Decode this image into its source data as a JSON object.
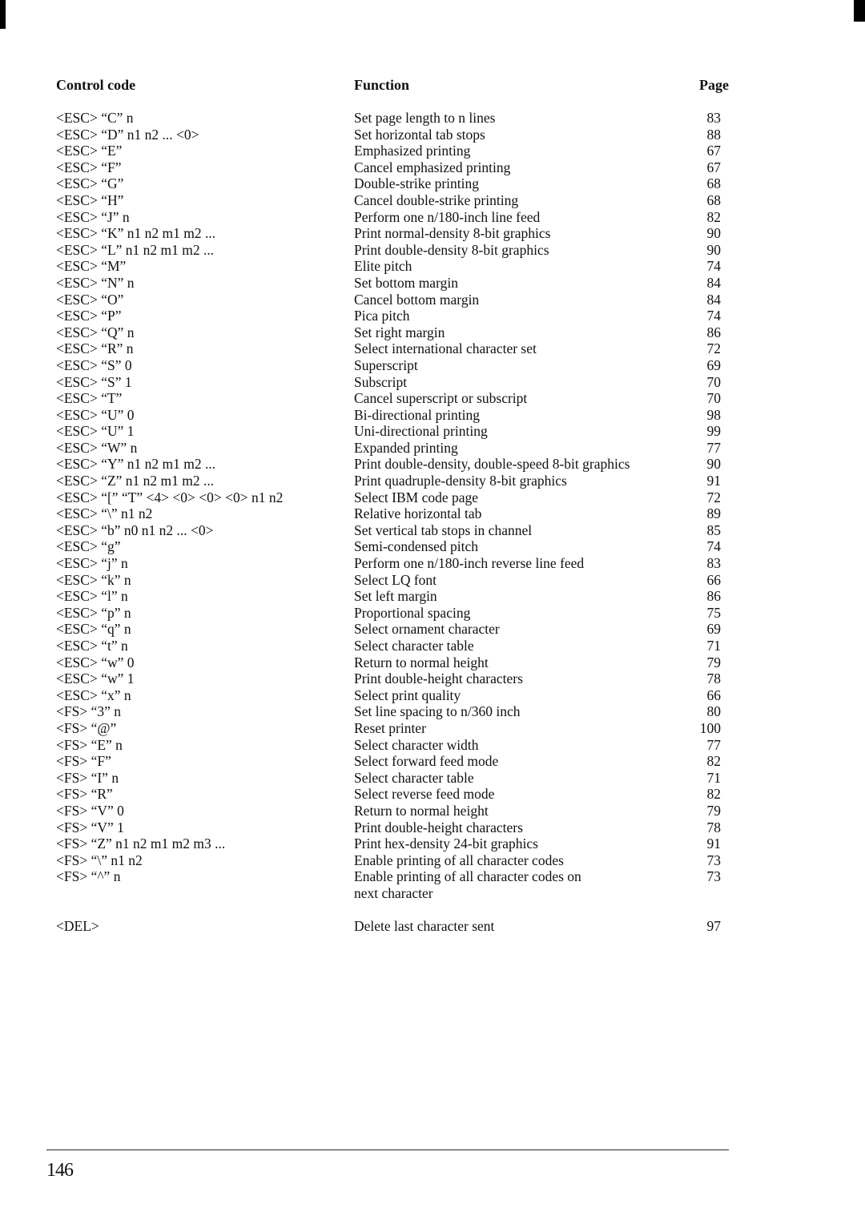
{
  "headers": {
    "control_code": "Control code",
    "function": "Function",
    "page": "Page"
  },
  "rows": [
    {
      "code": "<ESC> “C” n",
      "function": "Set page length to n lines",
      "page": "83"
    },
    {
      "code": "<ESC> “D” n1 n2 ... <0>",
      "function": "Set horizontal tab stops",
      "page": "88"
    },
    {
      "code": "<ESC> “E”",
      "function": "Emphasized printing",
      "page": "67"
    },
    {
      "code": "<ESC> “F”",
      "function": "Cancel emphasized printing",
      "page": "67"
    },
    {
      "code": "<ESC> “G”",
      "function": "Double-strike printing",
      "page": "68"
    },
    {
      "code": "<ESC> “H”",
      "function": "Cancel double-strike printing",
      "page": "68"
    },
    {
      "code": "<ESC> “J” n",
      "function": "Perform one n/180-inch line feed",
      "page": "82"
    },
    {
      "code": "<ESC> “K” n1 n2 m1 m2 ...",
      "function": "Print normal-density 8-bit graphics",
      "page": "90"
    },
    {
      "code": "<ESC> “L” n1 n2 m1 m2 ...",
      "function": "Print double-density 8-bit graphics",
      "page": "90"
    },
    {
      "code": "<ESC> “M”",
      "function": "Elite pitch",
      "page": "74"
    },
    {
      "code": "<ESC> “N” n",
      "function": "Set bottom margin",
      "page": "84"
    },
    {
      "code": "<ESC> “O”",
      "function": "Cancel bottom margin",
      "page": "84"
    },
    {
      "code": "<ESC> “P”",
      "function": "Pica pitch",
      "page": "74"
    },
    {
      "code": "<ESC> “Q” n",
      "function": "Set right margin",
      "page": "86"
    },
    {
      "code": "<ESC> “R” n",
      "function": "Select international character set",
      "page": "72"
    },
    {
      "code": "<ESC> “S” 0",
      "function": "Superscript",
      "page": "69"
    },
    {
      "code": "<ESC> “S” 1",
      "function": "Subscript",
      "page": "70"
    },
    {
      "code": "<ESC> “T”",
      "function": "Cancel superscript or subscript",
      "page": "70"
    },
    {
      "code": "<ESC> “U” 0",
      "function": "Bi-directional printing",
      "page": "98"
    },
    {
      "code": "<ESC> “U” 1",
      "function": "Uni-directional printing",
      "page": "99"
    },
    {
      "code": "<ESC> “W” n",
      "function": "Expanded printing",
      "page": "77"
    },
    {
      "code": "<ESC> “Y” n1 n2 m1 m2 ...",
      "function": "Print double-density, double-speed 8-bit graphics",
      "page": "90"
    },
    {
      "code": "<ESC> “Z” n1 n2 m1 m2 ...",
      "function": "Print quadruple-density 8-bit graphics",
      "page": "91"
    },
    {
      "code": "<ESC> “[” “T” <4> <0> <0> <0> n1 n2",
      "function": "Select IBM code page",
      "page": "72"
    },
    {
      "code": "<ESC> “\\” n1 n2",
      "function": "Relative horizontal tab",
      "page": "89"
    },
    {
      "code": "<ESC> “b” n0 n1 n2 ... <0>",
      "function": "Set vertical tab stops in channel",
      "page": "85"
    },
    {
      "code": "<ESC> “g”",
      "function": "Semi-condensed pitch",
      "page": "74"
    },
    {
      "code": "<ESC> “j” n",
      "function": "Perform one n/180-inch reverse line feed",
      "page": "83"
    },
    {
      "code": "<ESC> “k” n",
      "function": "Select LQ font",
      "page": "66"
    },
    {
      "code": "<ESC> “l” n",
      "function": "Set left margin",
      "page": "86"
    },
    {
      "code": "<ESC> “p” n",
      "function": "Proportional spacing",
      "page": "75"
    },
    {
      "code": "<ESC> “q” n",
      "function": "Select ornament character",
      "page": "69"
    },
    {
      "code": "<ESC> “t” n",
      "function": "Select character table",
      "page": "71"
    },
    {
      "code": "<ESC> “w” 0",
      "function": "Return to normal height",
      "page": "79"
    },
    {
      "code": "<ESC> “w” 1",
      "function": "Print double-height characters",
      "page": "78"
    },
    {
      "code": "<ESC> “x” n",
      "function": "Select print quality",
      "page": "66"
    },
    {
      "code": "<FS> “3” n",
      "function": "Set line spacing to n/360 inch",
      "page": "80"
    },
    {
      "code": "<FS> “@”",
      "function": "Reset printer",
      "page": "100"
    },
    {
      "code": "<FS> “E” n",
      "function": "Select character width",
      "page": "77"
    },
    {
      "code": "<FS> “F”",
      "function": "Select forward feed mode",
      "page": "82"
    },
    {
      "code": "<FS> “I” n",
      "function": "Select character table",
      "page": "71"
    },
    {
      "code": "<FS> “R”",
      "function": "Select reverse feed mode",
      "page": "82"
    },
    {
      "code": "<FS> “V” 0",
      "function": "Return to normal height",
      "page": "79"
    },
    {
      "code": "<FS> “V” 1",
      "function": "Print double-height characters",
      "page": "78"
    },
    {
      "code": "<FS> “Z” n1 n2 m1 m2 m3 ...",
      "function": "Print hex-density 24-bit graphics",
      "page": "91"
    },
    {
      "code": "<FS> “\\” n1 n2",
      "function": "Enable printing of all character codes",
      "page": "73"
    },
    {
      "code": "<FS> “^” n",
      "function": "Enable printing of all character codes on",
      "function_cont": "next character",
      "page": "73"
    },
    {
      "code": "<DEL>",
      "function": "Delete last character sent",
      "page": "97",
      "gap_before": true
    }
  ],
  "footer": {
    "page_number": "146"
  }
}
